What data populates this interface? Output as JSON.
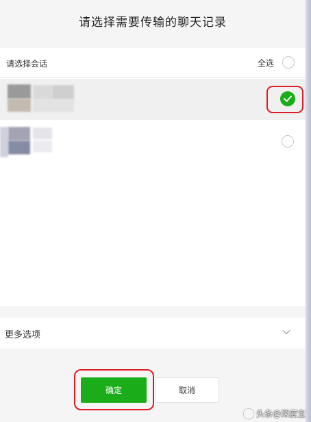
{
  "dialog": {
    "title": "请选择需要传输的聊天记录"
  },
  "list": {
    "header_label": "请选择会话",
    "select_all_label": "全选",
    "conversations": [
      {
        "selected": true
      },
      {
        "selected": false
      }
    ]
  },
  "more_options": {
    "label": "更多选项"
  },
  "buttons": {
    "confirm": "确定",
    "cancel": "取消"
  },
  "watermark": {
    "text": "头条@深度宝"
  },
  "colors": {
    "accent_green": "#1aad19",
    "highlight_red": "#e01b24"
  },
  "icons": {
    "checked": "check-icon",
    "chevron": "chevron-down-icon"
  }
}
